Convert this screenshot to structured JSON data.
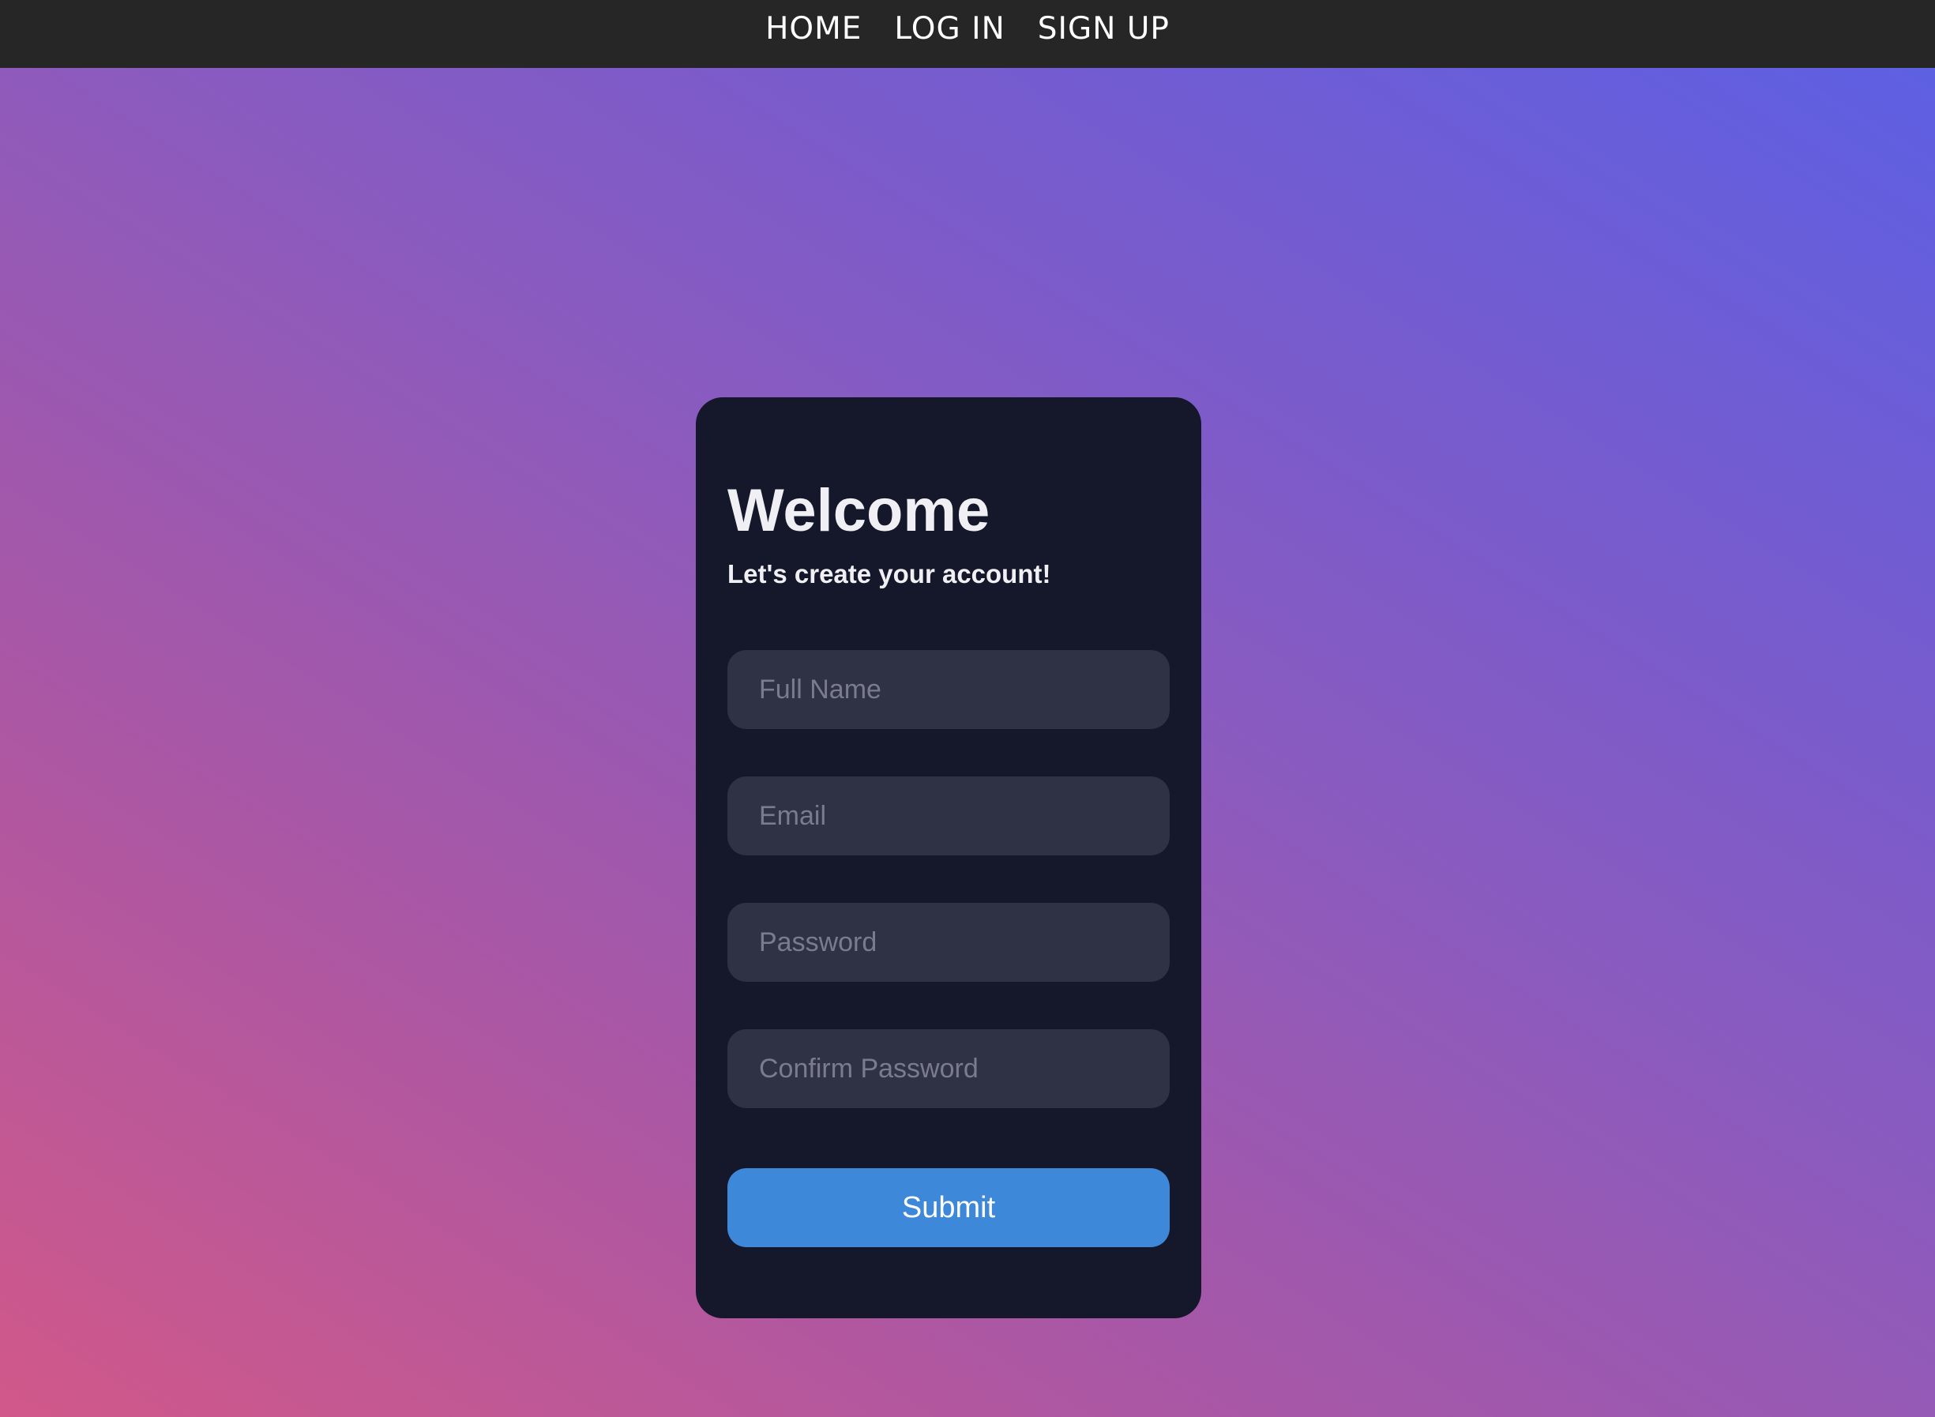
{
  "nav": {
    "items": [
      {
        "label": "HOME"
      },
      {
        "label": "LOG IN"
      },
      {
        "label": "SIGN UP"
      }
    ]
  },
  "card": {
    "title": "Welcome",
    "subtitle": "Let's create your account!",
    "fields": [
      {
        "placeholder": "Full Name",
        "value": ""
      },
      {
        "placeholder": "Email",
        "value": ""
      },
      {
        "placeholder": "Password",
        "value": ""
      },
      {
        "placeholder": "Confirm Password",
        "value": ""
      }
    ],
    "submit_label": "Submit"
  },
  "colors": {
    "topbar": "#262626",
    "card": "#15182a",
    "field": "#2f3144",
    "accent": "#3d88d8",
    "gradient_start": "#d15889",
    "gradient_end": "#5b60e5"
  }
}
